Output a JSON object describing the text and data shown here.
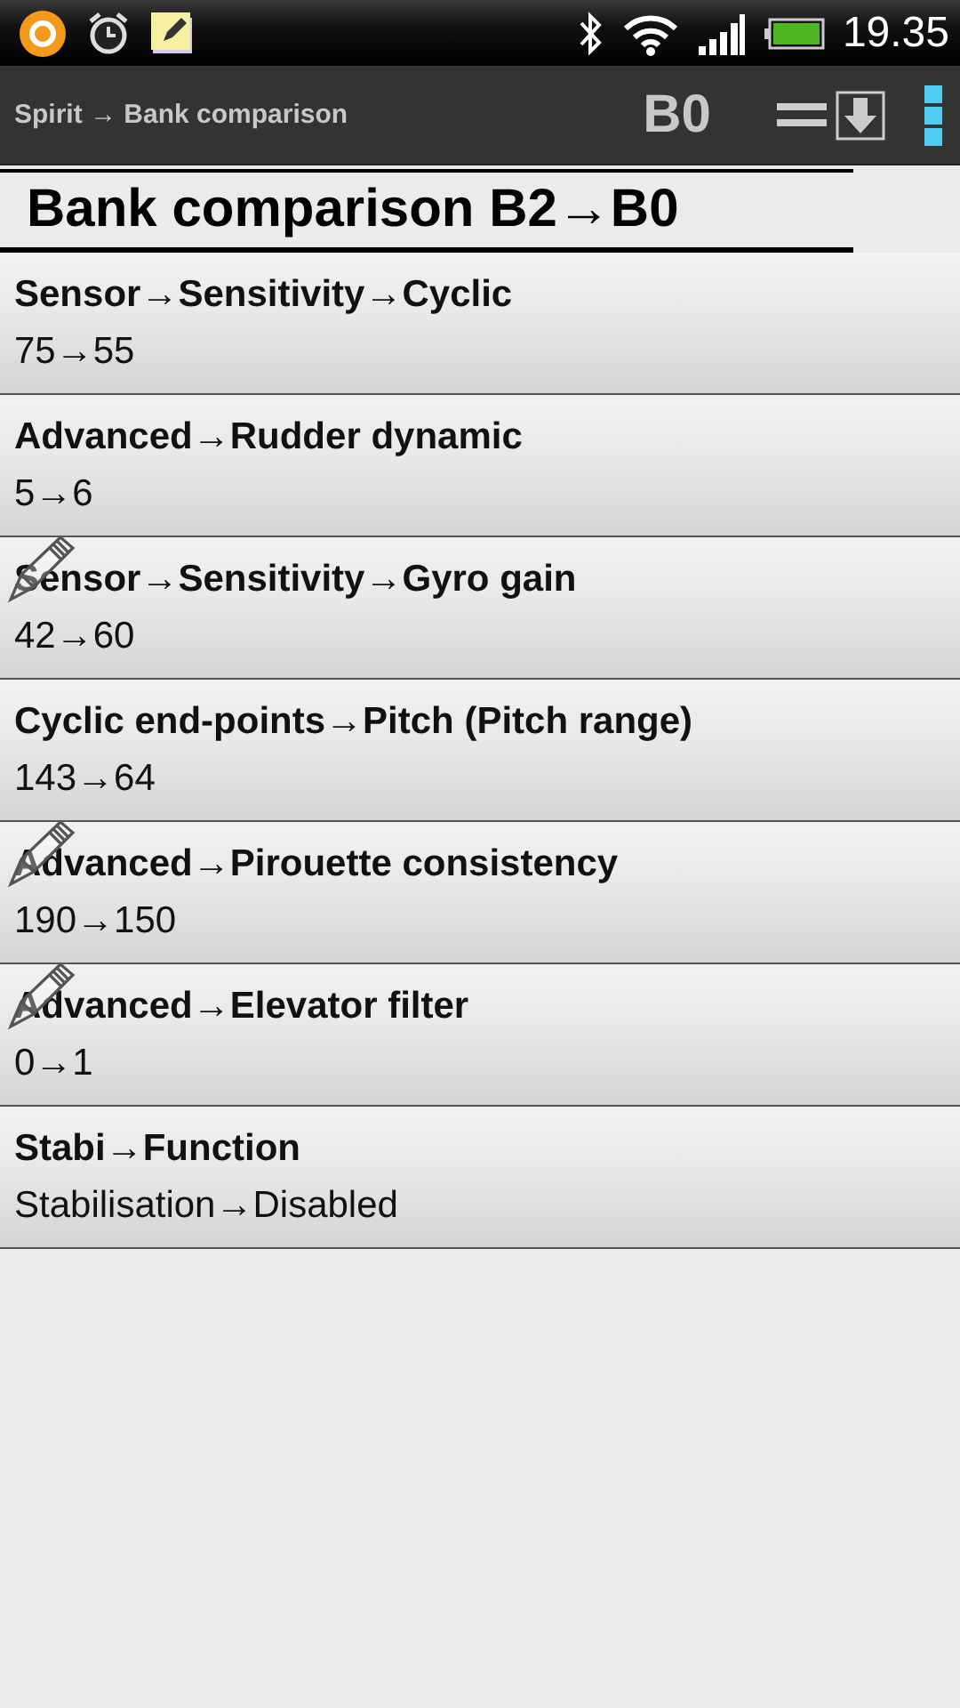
{
  "status_bar": {
    "time": "19.35"
  },
  "action_bar": {
    "breadcrumb": "Spirit → Bank comparison",
    "bank": "B0"
  },
  "heading": "Bank comparison B2→B0",
  "rows": [
    {
      "title": "Sensor→Sensitivity→Cyclic",
      "value": "75→55"
    },
    {
      "title": "Advanced→Rudder dynamic",
      "value": "5→6"
    },
    {
      "title": "Sensor→Sensitivity→Gyro gain",
      "value": "42→60",
      "pencil": true
    },
    {
      "title": "Cyclic end-points→Pitch (Pitch range)",
      "value": "143→64"
    },
    {
      "title": "Advanced→Pirouette consistency",
      "value": "190→150",
      "pencil": true
    },
    {
      "title": "Advanced→Elevator filter",
      "value": "0→1",
      "pencil": true
    },
    {
      "title": "Stabi→Function",
      "value": "Stabilisation→Disabled"
    }
  ]
}
